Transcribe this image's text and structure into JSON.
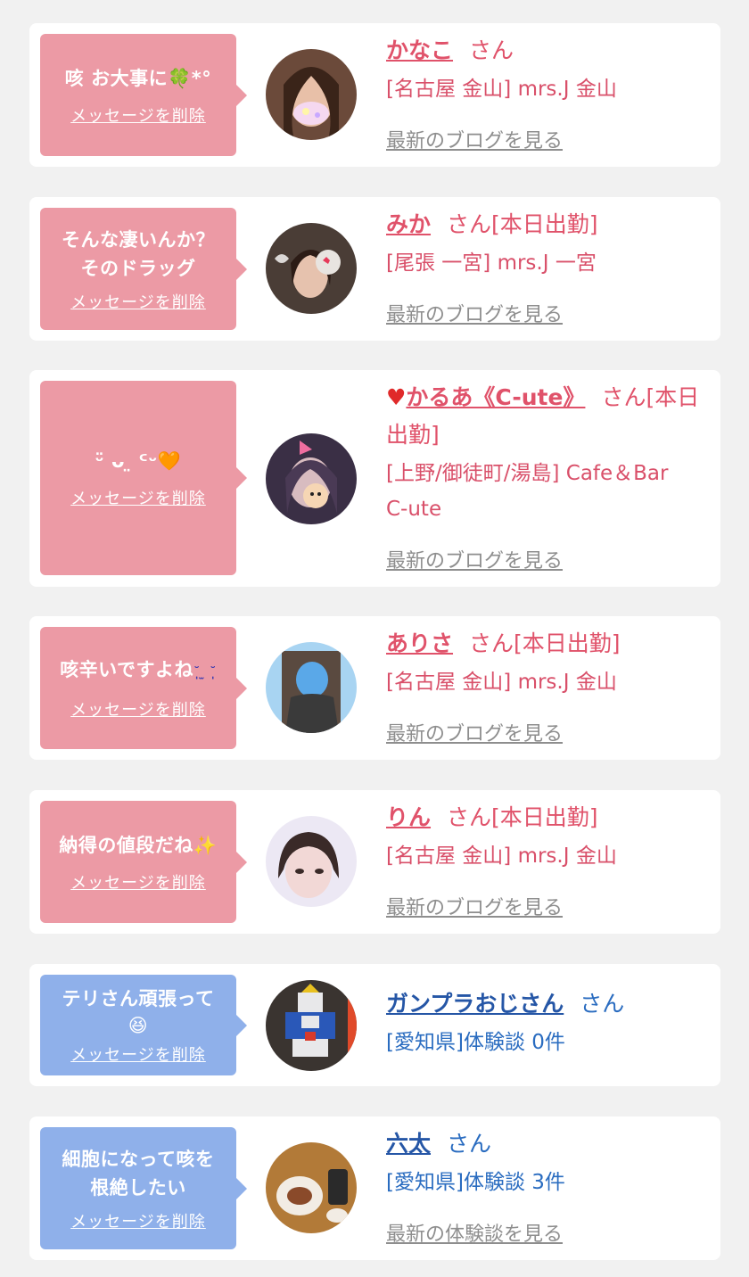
{
  "delete_label": "メッセージを削除",
  "colors": {
    "pink_bubble": "#ec9aa5",
    "blue_bubble": "#8fb0ea",
    "cast_name": "#e0526a",
    "user_name": "#2556a6",
    "link_gray": "#8e8e8e"
  },
  "cards": [
    {
      "message": "咳 お大事に",
      "message_emoji": "🍀*°",
      "name": "かなこ",
      "suffix": "さん",
      "shop": "[名古屋 金山] mrs.J 金山",
      "link": "最新のブログを見る",
      "avatar_icon": "cast-avatar-icon"
    },
    {
      "message": "そんな凄いんか？\nそのドラッグ",
      "message_emoji": "",
      "name": "みか",
      "suffix": "さん[本日出勤]",
      "shop": "[尾張 一宮] mrs.J 一宮",
      "link": "最新のブログを見る",
      "avatar_icon": "cast-avatar-icon"
    },
    {
      "message": "ᵕ̈ ᴗ ̤ ᑦᵕ",
      "message_emoji": "🧡",
      "name": "かるあ《C-ute》",
      "name_prefix": "♥",
      "suffix": "さん[本日\n出勤]",
      "shop": "[上野/御徒町/湯島] Cafe＆Bar\nC-ute",
      "link": "最新のブログを見る",
      "avatar_icon": "cast-avatar-icon"
    },
    {
      "message": "咳辛いですよね",
      "message_emoji": "˘̩̩ ̫ ˘̩̩",
      "name": "ありさ",
      "suffix": "さん[本日出勤]",
      "shop": "[名古屋 金山] mrs.J 金山",
      "link": "最新のブログを見る",
      "avatar_icon": "cast-avatar-icon"
    },
    {
      "message": "納得の値段だね",
      "message_emoji": "✨",
      "name": "りん",
      "suffix": "さん[本日出勤]",
      "shop": "[名古屋 金山] mrs.J 金山",
      "link": "最新のブログを見る",
      "avatar_icon": "cast-avatar-icon"
    },
    {
      "message": "テリさん頑張って\n😆",
      "message_emoji": "",
      "name": "ガンプラおじさん",
      "suffix": "さん",
      "shop": "[愛知県]体験談 0件",
      "link": "",
      "avatar_icon": "robot-avatar-icon"
    },
    {
      "message": "細胞になって咳を\n根絶したい",
      "message_emoji": "",
      "name": "六太",
      "suffix": "さん",
      "shop": "[愛知県]体験談 3件",
      "link": "最新の体験談を見る",
      "avatar_icon": "food-avatar-icon"
    }
  ]
}
